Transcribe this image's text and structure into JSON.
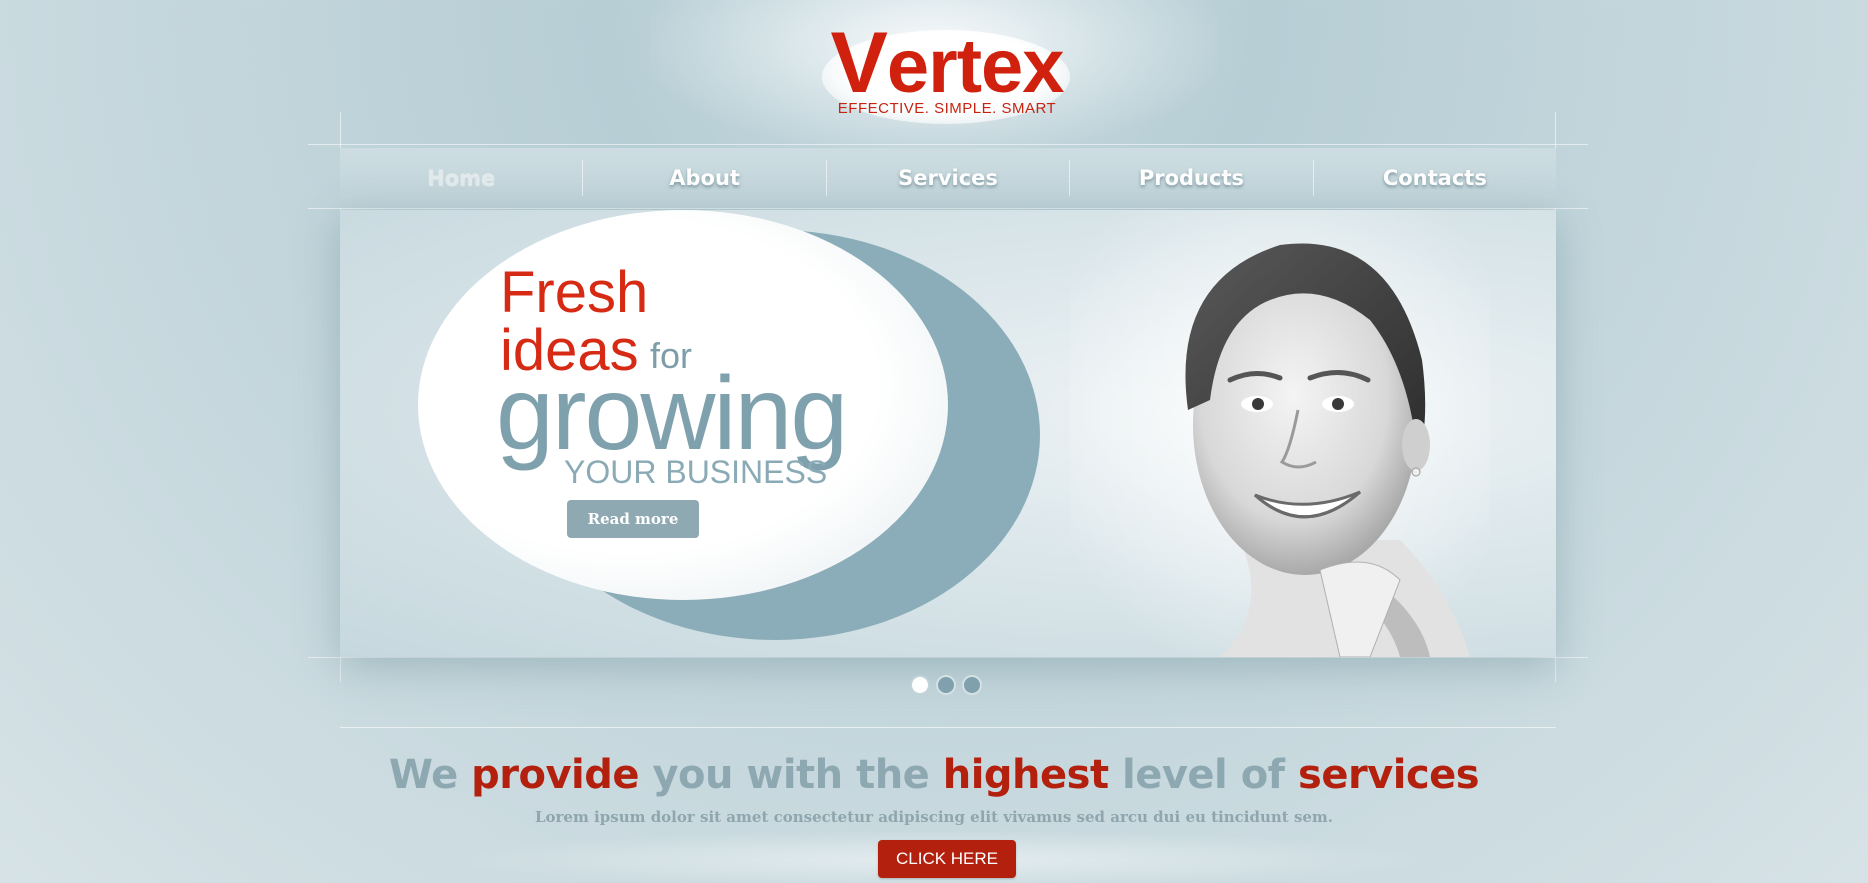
{
  "brand": {
    "logo_first": "V",
    "logo_rest": "ertex",
    "tagline": "EFFECTIVE. SIMPLE. SMART"
  },
  "nav": {
    "items": [
      {
        "label": "Home",
        "active": true
      },
      {
        "label": "About",
        "active": false
      },
      {
        "label": "Services",
        "active": false
      },
      {
        "label": "Products",
        "active": false
      },
      {
        "label": "Contacts",
        "active": false
      }
    ]
  },
  "hero": {
    "line1": "Fresh",
    "line2": "ideas",
    "line2_small": "for",
    "line3": "growing",
    "line4": "YOUR BUSINESS",
    "button_label": "Read more"
  },
  "slider": {
    "count": 3,
    "active_index": 0
  },
  "intro": {
    "headline_parts": [
      {
        "text": "We ",
        "style": "grey"
      },
      {
        "text": "provide ",
        "style": "red"
      },
      {
        "text": "you with the ",
        "style": "grey"
      },
      {
        "text": "highest ",
        "style": "red"
      },
      {
        "text": "level of ",
        "style": "grey"
      },
      {
        "text": "services",
        "style": "red"
      }
    ],
    "subtext": "Lorem ipsum dolor sit amet consectetur adipiscing elit vivamus sed arcu dui eu tincidunt sem.",
    "cta_label": "CLICK HERE"
  },
  "colors": {
    "brand_red": "#d0210f",
    "accent_red": "#b3200d",
    "steel_blue": "#8ea8b2",
    "background": "#c9dbe1"
  }
}
